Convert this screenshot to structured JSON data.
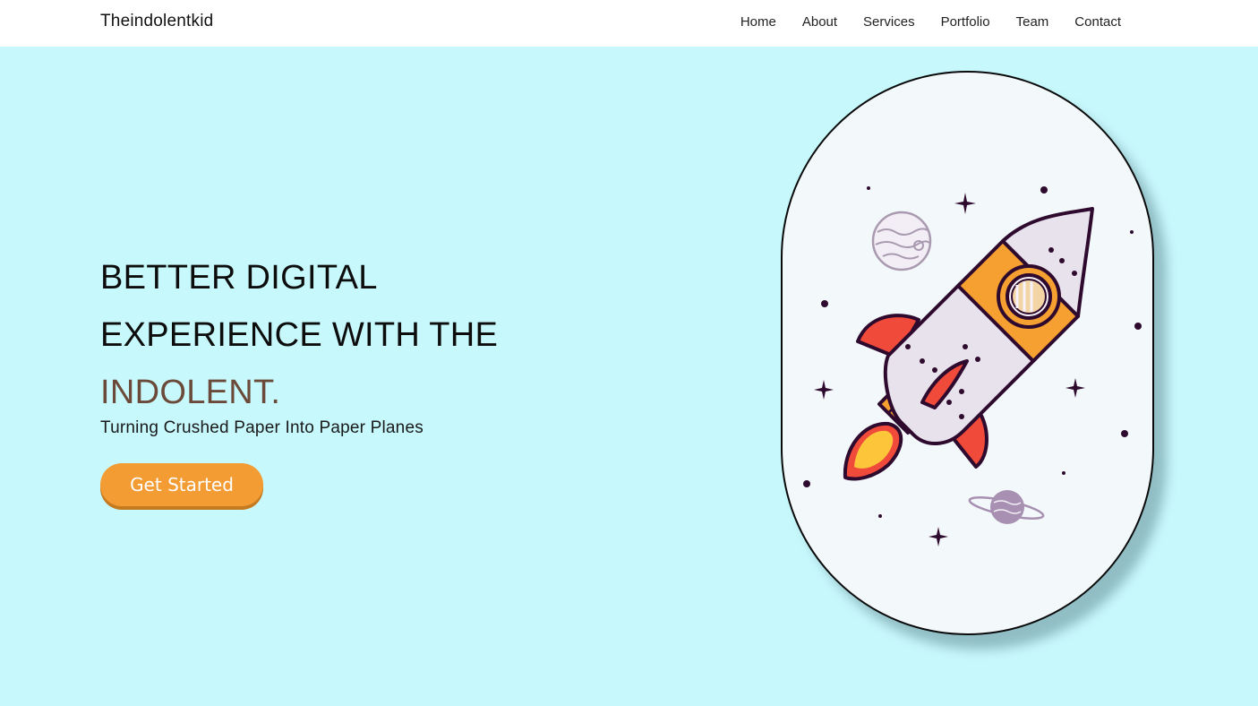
{
  "header": {
    "brand": "Theindolentkid",
    "nav": [
      {
        "label": "Home"
      },
      {
        "label": "About"
      },
      {
        "label": "Services"
      },
      {
        "label": "Portfolio"
      },
      {
        "label": "Team"
      },
      {
        "label": "Contact"
      }
    ]
  },
  "hero": {
    "headline_line1": "BETTER DIGITAL",
    "headline_line2": "EXPERIENCE WITH THE",
    "headline_accent": "INDOLENT.",
    "tagline": "Turning Crushed Paper Into Paper Planes",
    "cta_label": "Get Started"
  },
  "illustration": {
    "name": "rocket-illustration"
  },
  "colors": {
    "hero_background": "#c7f8fc",
    "accent_text": "#6b4a3a",
    "cta_background": "#f39c33",
    "rocket_orange": "#f5a030",
    "rocket_red": "#f04a3a",
    "outline": "#2e0a2e"
  }
}
